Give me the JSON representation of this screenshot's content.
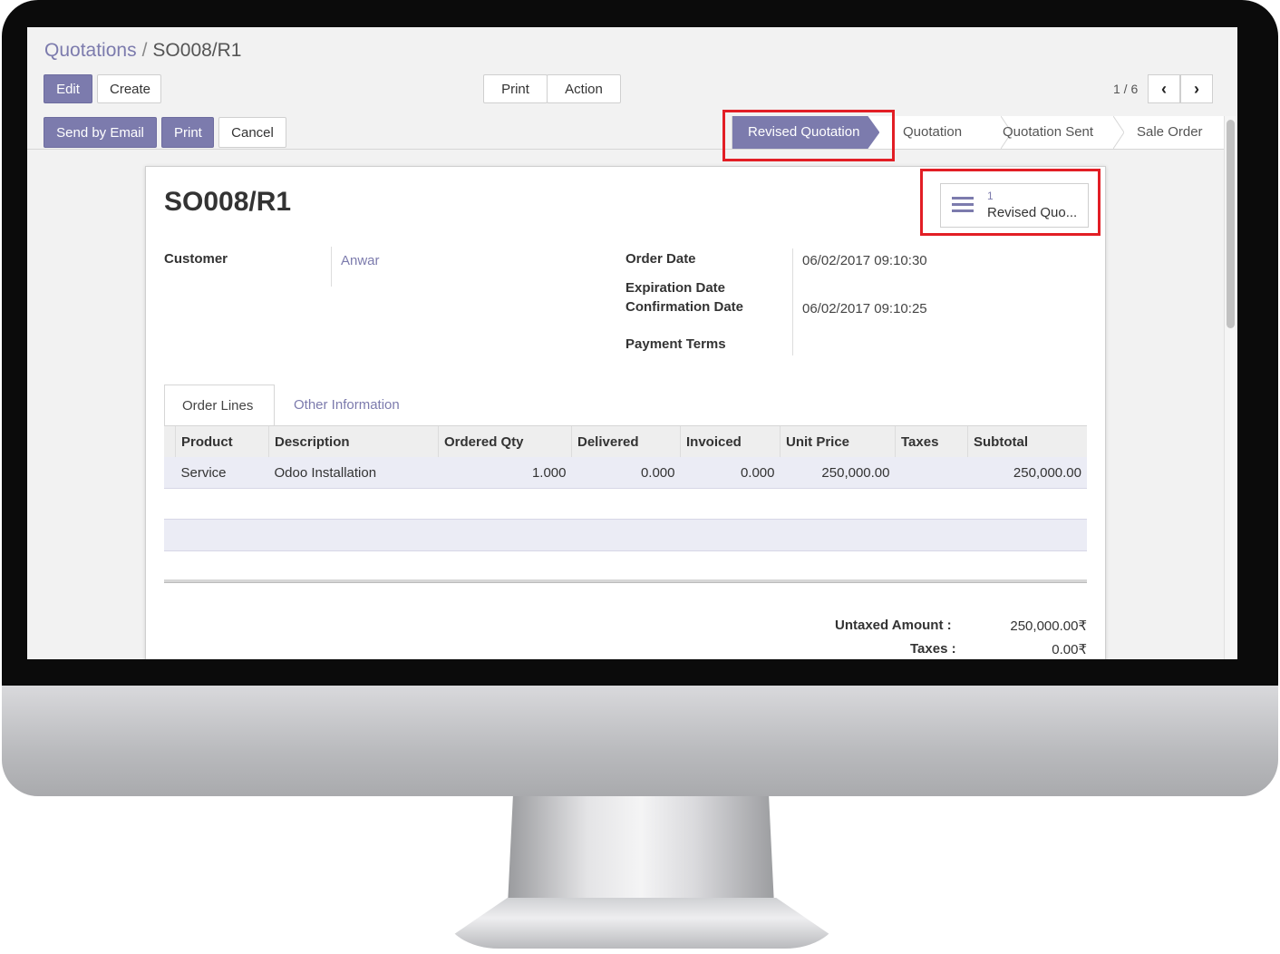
{
  "breadcrumb": {
    "parent": "Quotations",
    "separator": "/",
    "current": "SO008/R1"
  },
  "toolbar": {
    "edit": "Edit",
    "create": "Create",
    "print": "Print",
    "action": "Action"
  },
  "pager": {
    "value": "1 / 6"
  },
  "header_buttons": {
    "send_email": "Send by Email",
    "print": "Print",
    "cancel": "Cancel"
  },
  "stages": [
    "Revised Quotation",
    "Quotation",
    "Quotation Sent",
    "Sale Order"
  ],
  "active_stage": "Revised Quotation",
  "record": {
    "name": "SO008/R1"
  },
  "smart_button": {
    "count": "1",
    "label": "Revised Quo..."
  },
  "fields": {
    "customer_label": "Customer",
    "customer_value": "Anwar",
    "order_date_label": "Order Date",
    "order_date_value": "06/02/2017 09:10:30",
    "expiration_date_label": "Expiration Date",
    "confirmation_date_label": "Confirmation Date",
    "confirmation_date_value": "06/02/2017 09:10:25",
    "payment_terms_label": "Payment Terms"
  },
  "tabs": {
    "order_lines": "Order Lines",
    "other_info": "Other Information"
  },
  "table": {
    "headers": [
      "Product",
      "Description",
      "Ordered Qty",
      "Delivered",
      "Invoiced",
      "Unit Price",
      "Taxes",
      "Subtotal"
    ],
    "rows": [
      {
        "product": "Service",
        "description": "Odoo Installation",
        "ordered_qty": "1.000",
        "delivered": "0.000",
        "invoiced": "0.000",
        "unit_price": "250,000.00",
        "taxes": "",
        "subtotal": "250,000.00"
      }
    ]
  },
  "totals": {
    "untaxed_label": "Untaxed Amount :",
    "untaxed_value": "250,000.00₹",
    "taxes_label": "Taxes :",
    "taxes_value": "0.00₹"
  },
  "colors": {
    "brand": "#7c7bad",
    "highlight_box": "#e21e25"
  }
}
